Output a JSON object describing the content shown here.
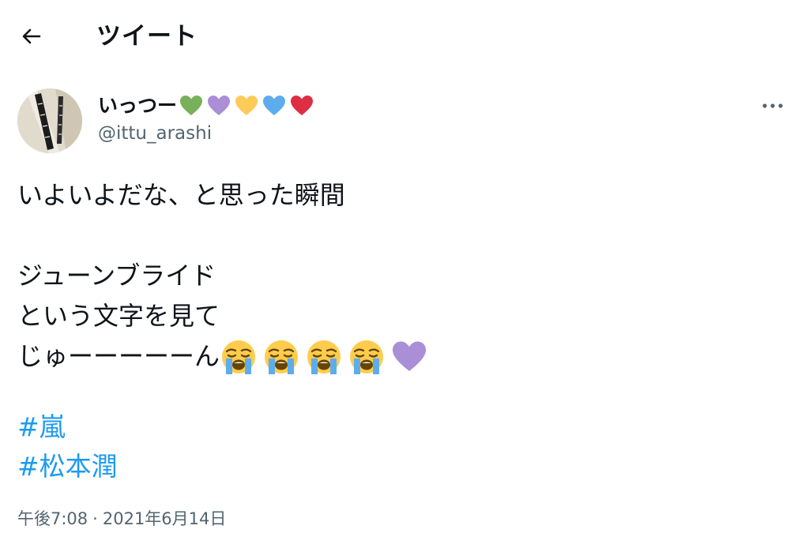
{
  "header": {
    "title": "ツイート",
    "back_icon": "arrow-left-icon"
  },
  "author": {
    "display_name": "いっつー",
    "handle": "@ittu_arashi",
    "name_hearts": [
      {
        "icon": "green-heart-icon",
        "color": "#78b159"
      },
      {
        "icon": "purple-heart-icon",
        "color": "#aa8ed6"
      },
      {
        "icon": "yellow-heart-icon",
        "color": "#fdcb58"
      },
      {
        "icon": "blue-heart-icon",
        "color": "#5dadec"
      },
      {
        "icon": "red-heart-icon",
        "color": "#dd2e44"
      }
    ],
    "more_icon": "more-icon"
  },
  "tweet": {
    "lines": [
      "いよいよだな、と思った瞬間",
      "",
      "ジューンブライド",
      "という文字を見て",
      "じゅーーーーーん"
    ],
    "trailing_emoji": [
      "loudly-crying-face-icon",
      "loudly-crying-face-icon",
      "loudly-crying-face-icon",
      "loudly-crying-face-icon",
      "purple-heart-icon"
    ],
    "hashtags": [
      "#嵐",
      "#松本潤"
    ]
  },
  "meta": {
    "time": "午後7:08",
    "separator": "·",
    "date": "2021年6月14日"
  },
  "colors": {
    "text": "#0f1419",
    "secondary": "#536471",
    "link": "#1d9bf0",
    "background": "#ffffff"
  }
}
